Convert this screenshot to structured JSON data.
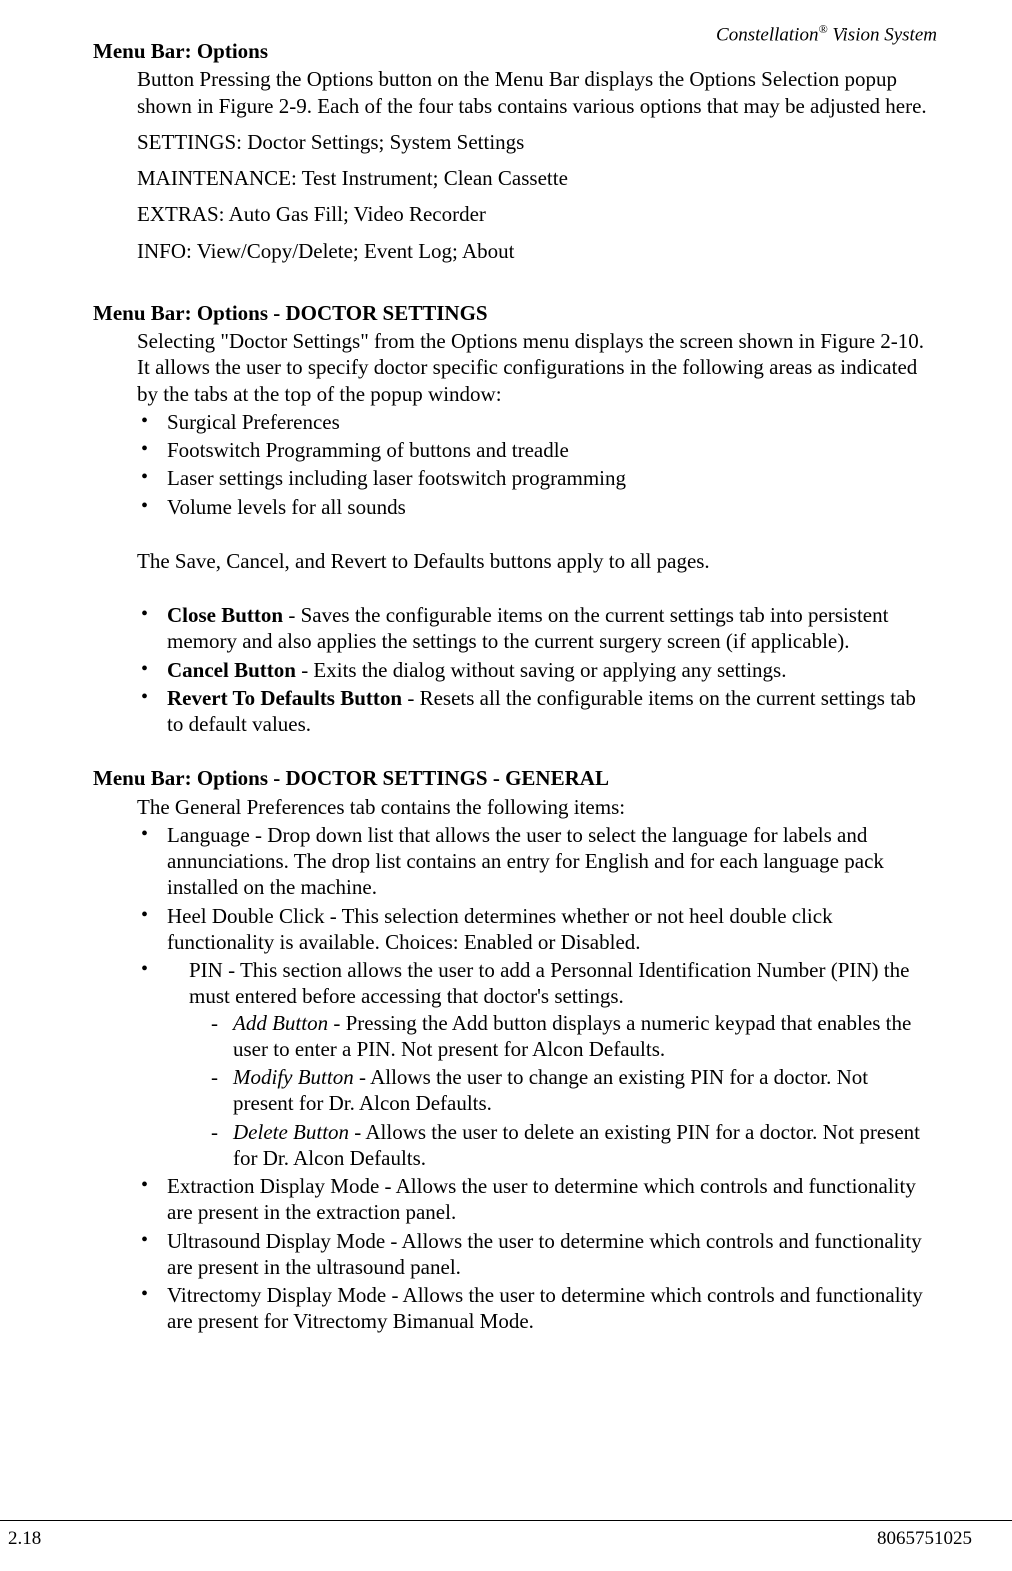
{
  "header": {
    "product": "Constellation",
    "suffix": " Vision System"
  },
  "sections": {
    "options": {
      "heading": "Menu Bar: Options",
      "p1": "Button Pressing the Options button on the Menu Bar displays the Options Selection popup shown in Figure 2-9. Each of the four tabs contains various options that may be adjusted here.",
      "p2": "SETTINGS: Doctor Settings; System Settings",
      "p3": "MAINTENANCE: Test Instrument; Clean Cassette",
      "p4": "EXTRAS: Auto Gas Fill; Video Recorder",
      "p5": "INFO: View/Copy/Delete; Event Log; About"
    },
    "doctor": {
      "heading": "Menu Bar: Options - DOCTOR SETTINGS",
      "p1": "Selecting \"Doctor Settings\" from the Options menu displays the screen shown in Figure 2-10.  It allows the user to specify doctor specific configurations in the following areas as indicated by the tabs at the top of the popup window:",
      "bullets1": [
        "Surgical Preferences",
        "Footswitch Programming of buttons and treadle",
        "Laser settings including laser footswitch programming",
        "Volume levels for all sounds"
      ],
      "p2": "The Save, Cancel, and Revert to Defaults buttons apply to all pages.",
      "buttons": [
        {
          "label": "Close Button",
          "text": " - Saves the configurable items on the current settings tab into persistent memory and also applies the settings to the current surgery screen (if applicable)."
        },
        {
          "label": "Cancel Button",
          "text": " - Exits the dialog without saving or applying any settings."
        },
        {
          "label": "Revert To Defaults Button",
          "text": " - Resets all the configurable items on the current settings tab to default values."
        }
      ]
    },
    "general": {
      "heading": "Menu Bar: Options - DOCTOR SETTINGS - GENERAL",
      "p1": "The General Preferences tab contains the following items:",
      "items": {
        "language": "Language - Drop down list that allows the user to select the language for labels and annunciations.  The drop list contains an entry for English and for each language pack installed on the machine.",
        "heel": "Heel Double Click - This selection determines whether or not heel double click functionality is available. Choices: Enabled or Disabled.",
        "pin": "PIN - This section allows the user to add a Personnal Identification Number (PIN) the must entered before accessing that doctor's settings.",
        "pin_sub": [
          {
            "label": "Add Button",
            "text": " - Pressing the Add button displays a numeric keypad that enables the user to enter a PIN.  Not present for Alcon Defaults."
          },
          {
            "label": "Modify Button",
            "text": " - Allows the user to change an existing PIN for a doctor. Not present for Dr. Alcon Defaults."
          },
          {
            "label": "Delete Button",
            "text": " - Allows the user to delete an existing PIN for a doctor.  Not present for Dr. Alcon Defaults."
          }
        ],
        "extraction": "Extraction Display Mode - Allows the user to determine which controls and functionality are present in the extraction panel.",
        "ultrasound": "Ultrasound Display Mode - Allows the user to determine which controls and functionality are present in the ultrasound panel.",
        "vitrectomy": "Vitrectomy Display Mode - Allows the user to determine which controls and functionality are present for Vitrectomy Bimanual Mode."
      }
    }
  },
  "footer": {
    "left": "2.18",
    "right": "8065751025"
  }
}
